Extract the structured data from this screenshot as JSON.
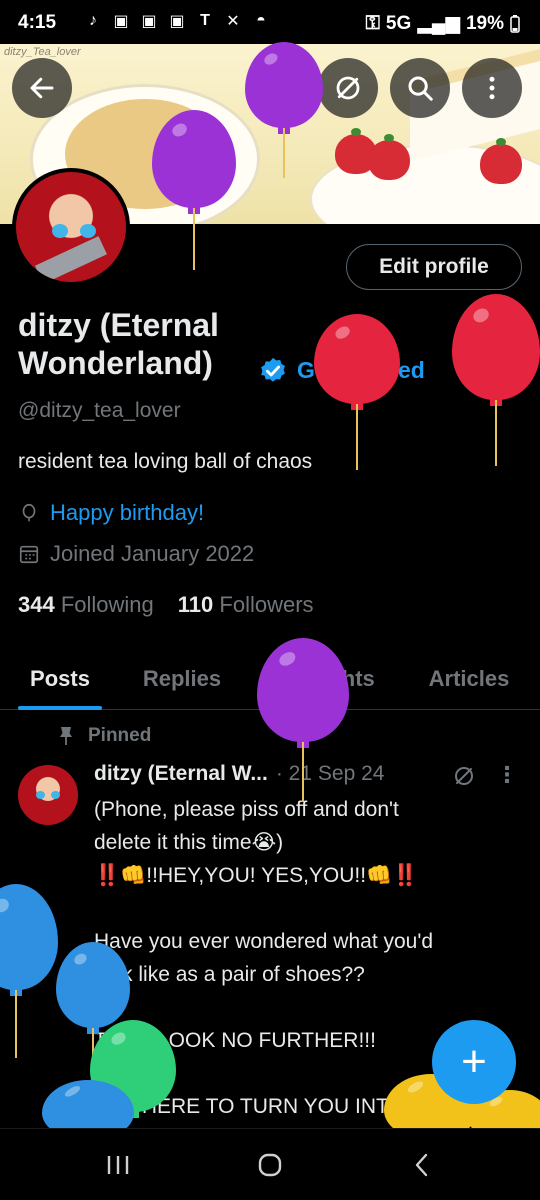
{
  "status_bar": {
    "time": "4:15",
    "network": "5G",
    "battery": "19%",
    "notification_icons": [
      "tiktok-icon",
      "twitch-icon",
      "twitch-icon",
      "twitch-icon",
      "tumblr-icon",
      "x-icon",
      "app-icon"
    ]
  },
  "header": {
    "banner_watermark": "ditzy_Tea_lover",
    "back_icon": "arrow-left-icon",
    "grok_icon": "grok-icon",
    "search_icon": "search-icon",
    "more_icon": "more-vertical-icon"
  },
  "profile": {
    "edit_profile_label": "Edit profile",
    "display_name": "ditzy (Eternal Wonderland)",
    "verified_badge_icon": "verified-check-icon",
    "get_verified_label": "Get Verified",
    "handle": "@ditzy_tea_lover",
    "bio": "resident tea loving ball of chaos",
    "birthday_link": "Happy birthday!",
    "joined": "Joined January 2022",
    "following_count": "344",
    "following_label": "Following",
    "followers_count": "110",
    "followers_label": "Followers"
  },
  "tabs": [
    {
      "label": "Posts",
      "active": true
    },
    {
      "label": "Replies",
      "active": false
    },
    {
      "label": "Highlights",
      "active": false
    },
    {
      "label": "Articles",
      "active": false
    }
  ],
  "post": {
    "pinned_label": "Pinned",
    "author": "ditzy (Eternal W...",
    "date": "· 21 Sep 24",
    "body": "(Phone, please piss off and don't\ndelete it this time😭)\n‼️👊!!HEY,YOU! YES,YOU!!👊‼️\n\nHave you ever wondered what you'd\nlook like as a pair of shoes??\n\nTHEN LOOK NO FURTHER!!!\n\nI AM HERE TO TURN YOU INTO"
  },
  "fab": {
    "label": "+"
  },
  "colors": {
    "accent": "#1d9bf0",
    "background": "#000000",
    "text_primary": "#e7e9ea",
    "text_secondary": "#71767b",
    "balloon_purple": "#9b32d6",
    "balloon_red": "#e5243f",
    "balloon_blue": "#2f8fe0",
    "balloon_green": "#2fcf7a",
    "balloon_yellow": "#f2c21b"
  },
  "nav_bar": [
    "recent-apps-icon",
    "home-icon",
    "back-icon"
  ]
}
